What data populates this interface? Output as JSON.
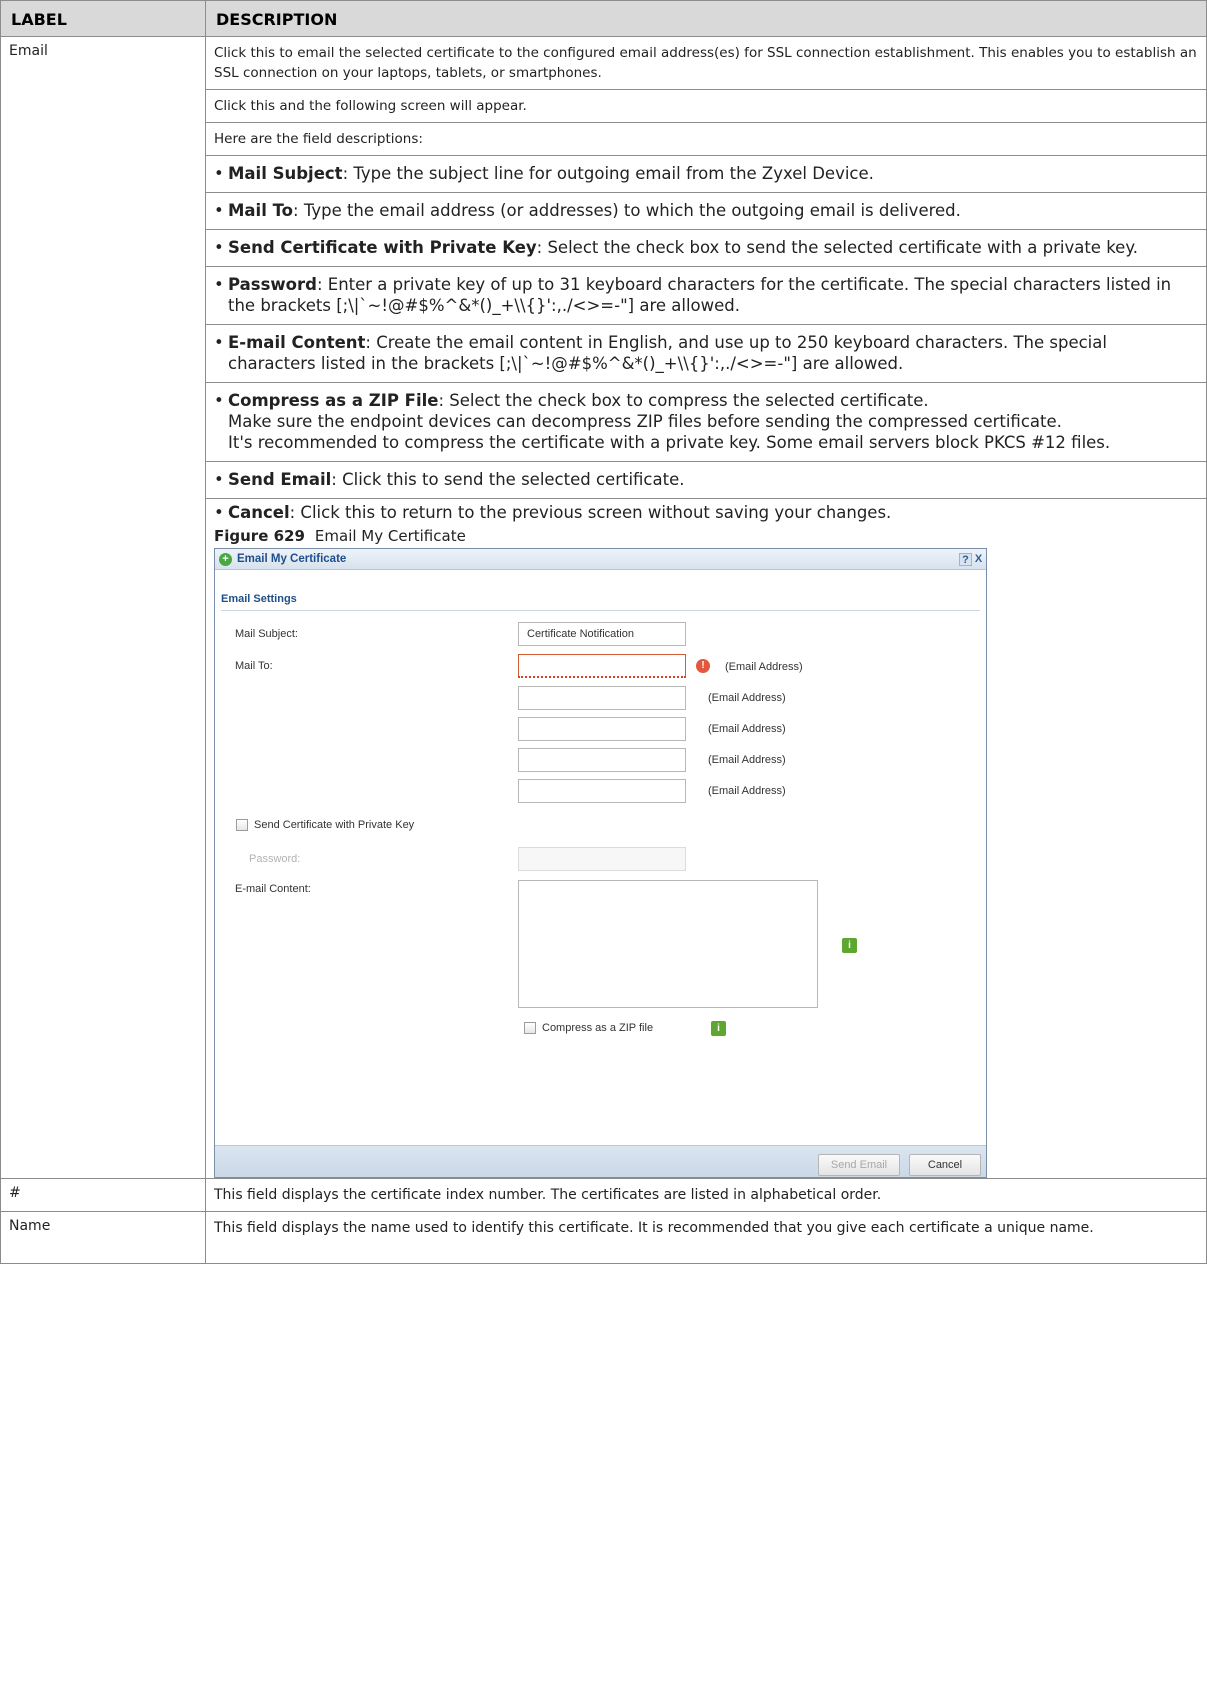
{
  "table": {
    "headers": {
      "label": "LABEL",
      "description": "DESCRIPTION"
    },
    "email_row": {
      "label": "Email",
      "p1": "Click this to email the selected certificate to the configured email address(es) for SSL connection establishment. This enables you to establish an SSL connection on your laptops, tablets, or smartphones.",
      "p2": "Click this and the following screen will appear.",
      "p3": "Here are the field descriptions:",
      "bullets": [
        {
          "term": "Mail Subject",
          "text": ": Type the subject line for outgoing email from the Zyxel Device."
        },
        {
          "term": "Mail To",
          "text": ": Type the email address (or addresses) to which the outgoing email is delivered."
        },
        {
          "term": "Send Certificate with Private Key",
          "text": ": Select the check box to send the selected certificate with a private key."
        },
        {
          "term": "Password",
          "text": ": Enter a private key of up to 31 keyboard characters for the certificate. The special characters listed in the brackets [;\\|`~!@#$%^&*()_+\\\\{}':,./<>=-\"] are allowed."
        },
        {
          "term": "E-mail Content",
          "text": ": Create the email content in English, and use up to 250 keyboard characters. The special characters listed in the brackets [;\\|`~!@#$%^&*()_+\\\\{}':,./<>=-\"] are allowed."
        },
        {
          "term": "Compress as a ZIP File",
          "text": ": Select the check box to compress the selected certificate.",
          "line2": "Make sure the endpoint devices can decompress ZIP files before sending the compressed certificate.",
          "line3": "It's recommended to compress the certificate with a private key. Some email servers block PKCS #12 files."
        },
        {
          "term": "Send Email",
          "text": ": Click this to send the selected certificate."
        },
        {
          "term": "Cancel",
          "text": ": Click this to return to the previous screen without saving your changes."
        }
      ],
      "figure": {
        "number": "Figure 629",
        "caption": "Email My Certificate"
      }
    },
    "rows": [
      {
        "label": "#",
        "text": "This field displays the certificate index number. The certificates are listed in alphabetical order."
      },
      {
        "label": "Name",
        "text": "This field displays the name used to identify this certificate. It is recommended that you give each certificate a unique name."
      }
    ]
  },
  "dialog": {
    "title": "Email My Certificate",
    "help_glyph": "?",
    "close_glyph": "X",
    "section": "Email Settings",
    "mail_subject_label": "Mail Subject:",
    "mail_subject_value": "Certificate Notification",
    "mail_to_label": "Mail To:",
    "email_address_hint": "(Email Address)",
    "send_cert_label": "Send Certificate with Private Key",
    "password_label": "Password:",
    "content_label": "E-mail Content:",
    "compress_label": "Compress as a ZIP file",
    "info_glyph": "i",
    "error_glyph": "!",
    "send_button": "Send Email",
    "cancel_button": "Cancel",
    "colors": {
      "accent": "#1f4f8a",
      "error": "#e2583e",
      "info": "#5da731"
    }
  }
}
